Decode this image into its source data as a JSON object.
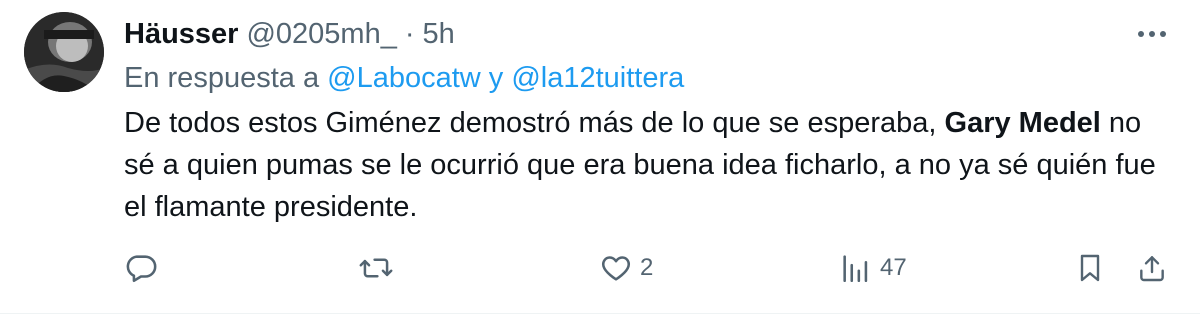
{
  "tweet": {
    "author_name": "Häusser",
    "handle": "@0205mh_",
    "separator": "·",
    "time": "5h",
    "reply_prefix": "En respuesta a",
    "reply_to_1": "@Labocatw",
    "reply_joiner": "y",
    "reply_to_2": "@la12tuittera",
    "text_part1": "De todos estos Giménez demostró más de lo que se esperaba,",
    "text_bold": "Gary Medel",
    "text_part2": "no sé a quien pumas se le ocurrió que era buena idea ficharlo, a no ya sé quién fue el flamante presidente.",
    "likes": "2",
    "views": "47"
  },
  "icons": {
    "more": "more-horizontal-icon",
    "reply": "reply-bubble-icon",
    "retweet": "retweet-icon",
    "like": "heart-icon",
    "views": "analytics-bars-icon",
    "bookmark": "bookmark-icon",
    "share": "share-upload-icon"
  },
  "colors": {
    "text": "#0f1419",
    "secondary": "#536471",
    "link": "#1d9bf0"
  }
}
